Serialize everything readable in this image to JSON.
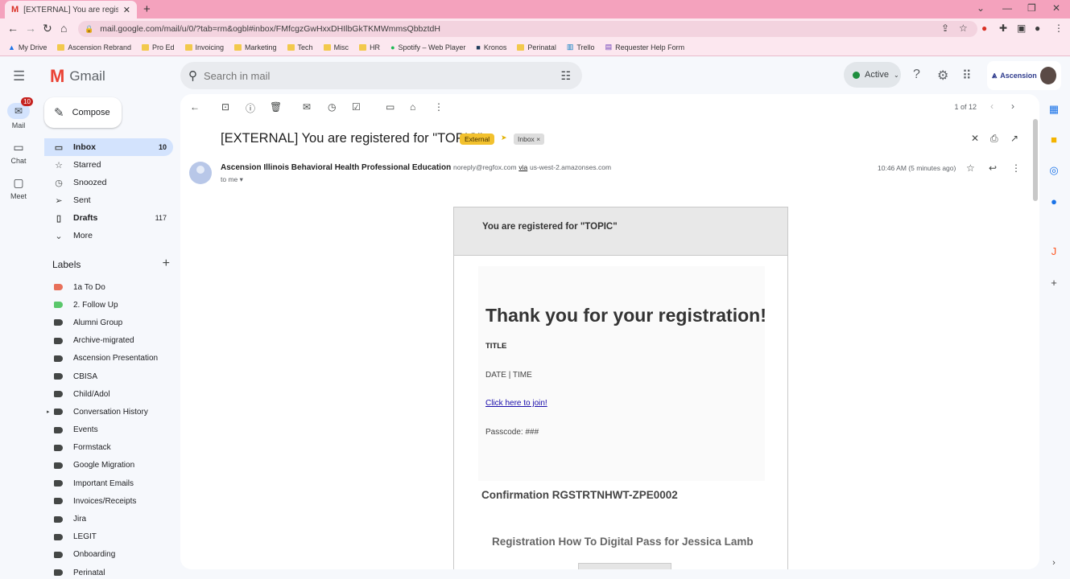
{
  "browser": {
    "tab_title": "[EXTERNAL] You are registered fo",
    "url": "mail.google.com/mail/u/0/?tab=rm&ogbl#inbox/FMfcgzGwHxxDHIlbGkTKMWmmsQbbztdH",
    "bookmarks": [
      {
        "label": "My Drive",
        "icon": "drive-icon"
      },
      {
        "label": "Ascension Rebrand",
        "icon": "folder"
      },
      {
        "label": "Pro Ed",
        "icon": "folder"
      },
      {
        "label": "Invoicing",
        "icon": "folder"
      },
      {
        "label": "Marketing",
        "icon": "folder"
      },
      {
        "label": "Tech",
        "icon": "folder"
      },
      {
        "label": "Misc",
        "icon": "folder"
      },
      {
        "label": "HR",
        "icon": "folder"
      },
      {
        "label": "Spotify – Web Player",
        "icon": "spotify-icon"
      },
      {
        "label": "Kronos",
        "icon": "kronos-icon"
      },
      {
        "label": "Perinatal",
        "icon": "folder"
      },
      {
        "label": "Trello",
        "icon": "trello-icon"
      },
      {
        "label": "Requester Help Form",
        "icon": "form-icon"
      }
    ]
  },
  "gmail": {
    "brand": "Gmail",
    "search_placeholder": "Search in mail",
    "status": "Active",
    "org_badge": "Ascension"
  },
  "rail": {
    "mail": "Mail",
    "mail_badge": "10",
    "chat": "Chat",
    "meet": "Meet"
  },
  "sidebar": {
    "compose": "Compose",
    "nav": [
      {
        "label": "Inbox",
        "count": "10",
        "icon": "inbox-icon"
      },
      {
        "label": "Starred",
        "count": "",
        "icon": "star-icon"
      },
      {
        "label": "Snoozed",
        "count": "",
        "icon": "clock-icon"
      },
      {
        "label": "Sent",
        "count": "",
        "icon": "send-icon"
      },
      {
        "label": "Drafts",
        "count": "117",
        "icon": "draft-icon"
      },
      {
        "label": "More",
        "count": "",
        "icon": "chevron-down-icon"
      }
    ],
    "labels_title": "Labels",
    "labels": [
      {
        "label": "1a To Do",
        "color": "#e8705a"
      },
      {
        "label": "2. Follow Up",
        "color": "#5ac76b"
      },
      {
        "label": "Alumni Group",
        "color": "#444746"
      },
      {
        "label": "Archive-migrated",
        "color": "#444746"
      },
      {
        "label": "Ascension Presentation",
        "color": "#444746"
      },
      {
        "label": "CBISA",
        "color": "#444746"
      },
      {
        "label": "Child/Adol",
        "color": "#444746"
      },
      {
        "label": "Conversation History",
        "color": "#444746"
      },
      {
        "label": "Events",
        "color": "#444746"
      },
      {
        "label": "Formstack",
        "color": "#444746"
      },
      {
        "label": "Google Migration",
        "color": "#444746"
      },
      {
        "label": "Important Emails",
        "color": "#444746"
      },
      {
        "label": "Invoices/Receipts",
        "color": "#444746"
      },
      {
        "label": "Jira",
        "color": "#444746"
      },
      {
        "label": "LEGIT",
        "color": "#444746"
      },
      {
        "label": "Onboarding",
        "color": "#444746"
      },
      {
        "label": "Perinatal",
        "color": "#444746"
      }
    ]
  },
  "message": {
    "pager": "1 of 12",
    "subject": "[EXTERNAL] You are registered for \"TOPIC\"",
    "chip_external": "External",
    "chip_inbox": "Inbox",
    "sender_name": "Ascension Illinois Behavioral Health Professional Education",
    "sender_email": "noreply@regfox.com",
    "via": "via",
    "via_host": "us-west-2.amazonses.com",
    "to": "to me",
    "time": "10:46 AM (5 minutes ago)"
  },
  "email_body": {
    "header": "You are registered for \"TOPIC\"",
    "thank_you": "Thank you for your registration!",
    "title": "TITLE",
    "date_time": "DATE | TIME",
    "join_link": "Click here to join!",
    "passcode": "Passcode: ###",
    "confirmation": "Confirmation RGSTRTNHWT-ZPE0002",
    "how_to": "Registration How To Digital Pass for Jessica Lamb"
  }
}
